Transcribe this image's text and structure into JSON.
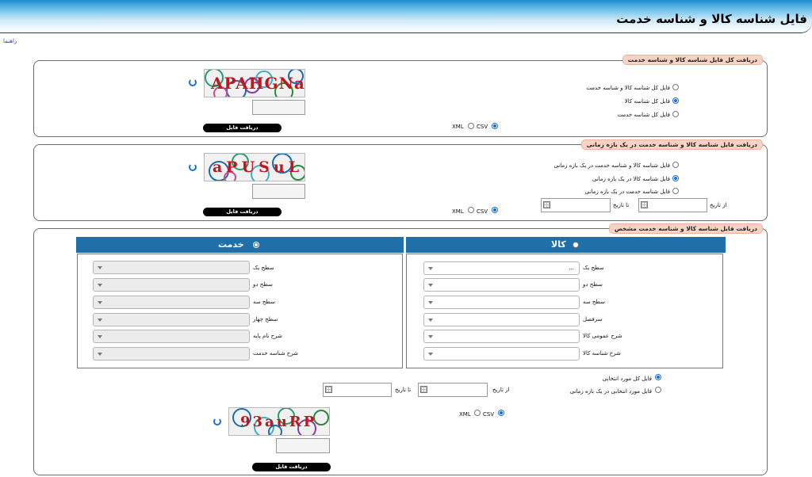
{
  "header": {
    "title": "فایل شناسه کالا و شناسه خدمت",
    "help_link": "راهنما"
  },
  "buttons": {
    "download": "دریافت فایل"
  },
  "format": {
    "xml": "XML",
    "csv": "CSV"
  },
  "section1": {
    "legend": "دریافت کل فایل شناسه کالا و شناسه خدمت",
    "options": [
      "فایل کل شناسه کالا و شناسه خدمت",
      "فایل کل شناسه کالا",
      "فایل کل شناسه خدمت"
    ],
    "selected_option": 1,
    "captcha_text": "APAHGNa"
  },
  "section2": {
    "legend": "دریافت فایل شناسه کالا و شناسه خدمت در یک بازه زمانی",
    "options": [
      "فایل شناسه کالا و شناسه خدمت در یک بازه زمانی",
      "فایل شناسه کالا در یک بازه زمانی",
      "فایل شناسه خدمت در یک بازه زمانی"
    ],
    "selected_option": 1,
    "from_label": "از تاریخ",
    "to_label": "تا تاریخ",
    "captcha_text": "aPUSuL"
  },
  "section3": {
    "legend": "دریافت فایل شناسه کالا و شناسه خدمت مشخص",
    "kala": {
      "title": "کالا",
      "fields": [
        {
          "label": "سطح یک",
          "value": "..."
        },
        {
          "label": "سطح دو",
          "value": ""
        },
        {
          "label": "سطح سه",
          "value": ""
        },
        {
          "label": "سرفصل",
          "value": ""
        },
        {
          "label": "شرح عمومی کالا",
          "value": ""
        },
        {
          "label": "شرح شناسه کالا",
          "value": ""
        }
      ]
    },
    "khedmat": {
      "title": "خدمت",
      "fields": [
        {
          "label": "سطح یک",
          "value": ""
        },
        {
          "label": "سطح دو",
          "value": ""
        },
        {
          "label": "سطح سه",
          "value": ""
        },
        {
          "label": "سطح چهار",
          "value": ""
        },
        {
          "label": "شرح نام پایه",
          "value": ""
        },
        {
          "label": "شرح شناسه خدمت",
          "value": ""
        }
      ]
    },
    "options": [
      "فایل کل مورد انتخابی",
      "فایل مورد انتخابی در یک بازه زمانی"
    ],
    "selected_option": 0,
    "from_label": "از تاریخ",
    "to_label": "تا تاریخ",
    "captcha_text": "93auRP"
  },
  "colors": {
    "accent": "#1f6faa",
    "legend_bg": "#f9d2c4",
    "radio": "#1a6fdc"
  }
}
